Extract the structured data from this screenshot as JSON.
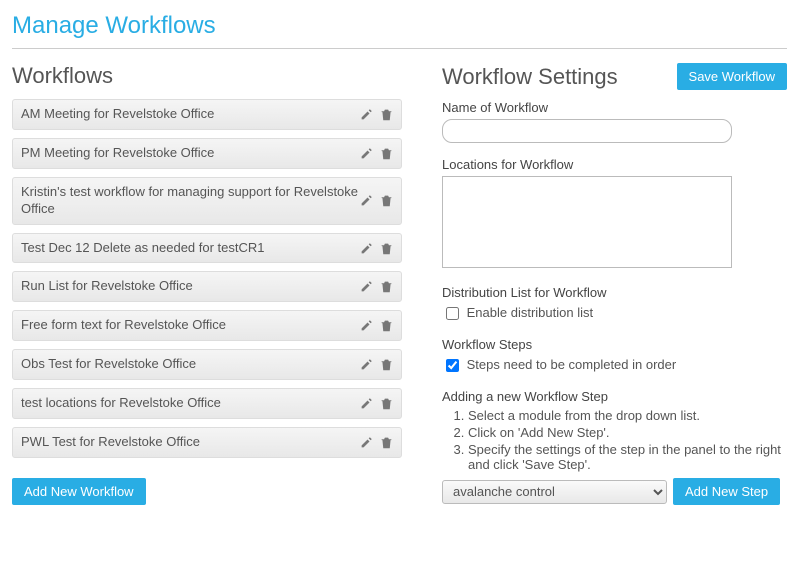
{
  "pageTitle": "Manage Workflows",
  "left": {
    "heading": "Workflows",
    "addBtn": "Add New Workflow",
    "items": [
      "AM Meeting for Revelstoke Office",
      "PM Meeting for Revelstoke Office",
      "Kristin's test workflow for managing support for Revelstoke Office",
      "Test Dec 12 Delete as needed for testCR1",
      "Run List for Revelstoke Office",
      "Free form text for Revelstoke Office",
      "Obs Test for Revelstoke Office",
      "test locations for Revelstoke Office",
      "PWL Test for Revelstoke Office"
    ]
  },
  "right": {
    "heading": "Workflow Settings",
    "saveBtn": "Save Workflow",
    "nameLabel": "Name of Workflow",
    "nameValue": "",
    "locLabel": "Locations for Workflow",
    "distLabel": "Distribution List for Workflow",
    "distCheck": "Enable distribution list",
    "distChecked": false,
    "stepsLabel": "Workflow Steps",
    "stepsCheck": "Steps need to be completed in order",
    "stepsChecked": true,
    "addStepLabel": "Adding a new Workflow Step",
    "instructions": [
      "Select a module from the drop down list.",
      "Click on 'Add New Step'.",
      "Specify the settings of the step in the panel to the right and click 'Save Step'."
    ],
    "moduleSelected": "avalanche control",
    "addStepBtn": "Add New Step"
  },
  "icons": {
    "edit": "pencil-icon",
    "delete": "trash-icon"
  }
}
